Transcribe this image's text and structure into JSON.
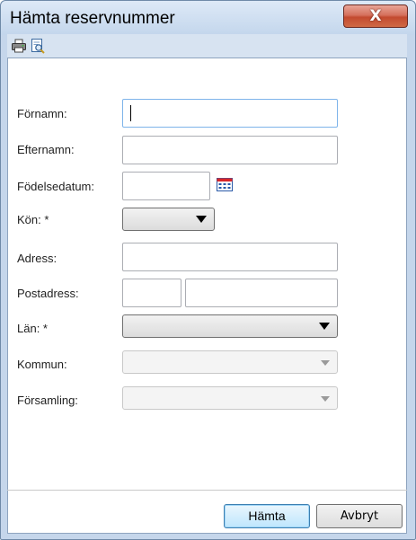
{
  "window": {
    "title": "Hämta reservnummer",
    "close_label": "X"
  },
  "toolbar": {
    "icons": [
      "printer-icon",
      "print-preview-icon"
    ]
  },
  "form": {
    "fornamn": {
      "label": "Förnamn:",
      "value": ""
    },
    "efternamn": {
      "label": "Efternamn:",
      "value": ""
    },
    "fodelsedatum": {
      "label": "Födelsedatum:",
      "value": ""
    },
    "kon": {
      "label": "Kön: *",
      "selected": ""
    },
    "adress": {
      "label": "Adress:",
      "value": ""
    },
    "postadress": {
      "label": "Postadress:",
      "postnummer": "",
      "ort": ""
    },
    "lan": {
      "label": "Län: *",
      "selected": ""
    },
    "kommun": {
      "label": "Kommun:",
      "selected": ""
    },
    "forsamling": {
      "label": "Församling:",
      "selected": ""
    }
  },
  "buttons": {
    "hamta": "Hämta",
    "avbryt": "Avbryt"
  },
  "colors": {
    "titlebar": "#c3d6ec",
    "close_button": "#c34a30",
    "calendar_icon": "#d9262a"
  }
}
